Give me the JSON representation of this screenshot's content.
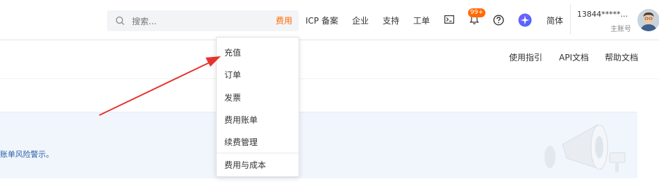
{
  "search": {
    "placeholder": "搜索..."
  },
  "nav": {
    "billing": "费用",
    "icp": "ICP 备案",
    "enterprise": "企业",
    "support": "支持",
    "ticket": "工单",
    "notifications_badge": "99+",
    "language": "简体"
  },
  "account": {
    "name": "13844*****...",
    "role": "主账号"
  },
  "sublinks": {
    "guide": "使用指引",
    "api_docs": "API文档",
    "help_docs": "帮助文档"
  },
  "banner": {
    "text": "账单风险警示。"
  },
  "dropdown": {
    "items": [
      "充值",
      "订单",
      "发票",
      "费用账单",
      "续费管理",
      "费用与成本"
    ]
  },
  "colors": {
    "accent": "#ff6a00",
    "arrow": "#e8322d",
    "banner_bg": "#f1f6fc",
    "link_blue": "#2a5ea8"
  },
  "icons": [
    "search-icon",
    "terminal-icon",
    "bell-icon",
    "help-icon",
    "sparkle-icon",
    "avatar",
    "megaphone-illustration",
    "red-arrow-annotation"
  ]
}
